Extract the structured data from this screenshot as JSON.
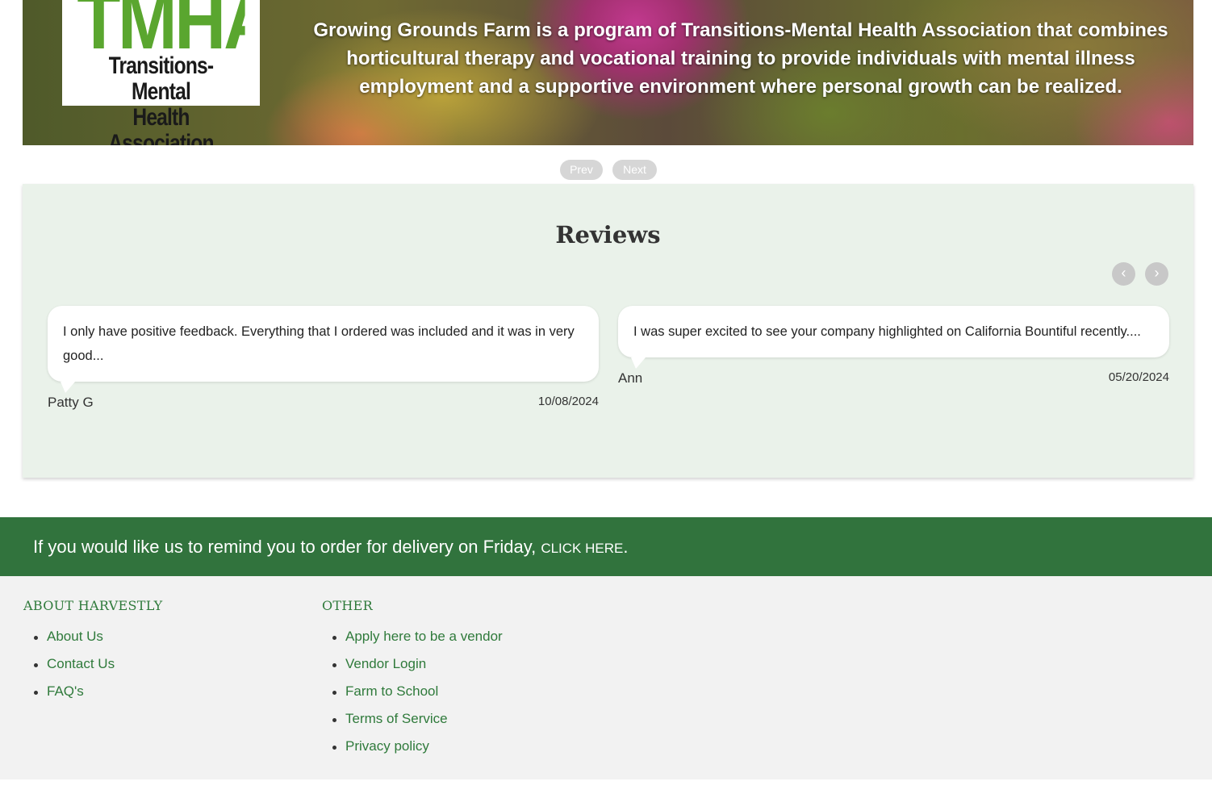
{
  "banner": {
    "logo_mark": "TMHA",
    "logo_name_line1": "Transitions-Mental",
    "logo_name_line2": "Health Association",
    "text": "Growing Grounds Farm is a program of Transitions-Mental Health Association that combines horticultural therapy and vocational training to provide individuals with mental illness employment and a supportive environment where personal growth can be realized."
  },
  "slider": {
    "prev_label": "Prev",
    "next_label": "Next"
  },
  "reviews": {
    "title": "Reviews",
    "nav_prev_icon": "‹",
    "nav_next_icon": "›",
    "items": [
      {
        "text": "I only have positive feedback. Everything that I ordered was included and it was in very good...",
        "author": "Patty G",
        "date": "10/08/2024"
      },
      {
        "text": "I was super excited to see your company highlighted on California Bountiful recently....",
        "author": "Ann",
        "date": "05/20/2024"
      }
    ]
  },
  "reminder": {
    "text": "If you would like us to remind you to order for delivery on Friday, ",
    "link": "CLICK HERE",
    "suffix": "."
  },
  "footer": {
    "about": {
      "heading": "ABOUT HARVESTLY",
      "links": [
        "About Us",
        "Contact Us",
        "FAQ's"
      ]
    },
    "other": {
      "heading": "OTHER",
      "links": [
        "Apply here to be a vendor",
        "Vendor Login",
        "Farm to School",
        "Terms of Service",
        "Privacy policy"
      ]
    }
  },
  "colors": {
    "brand_green": "#31733d",
    "link_green": "#2f7a3b",
    "reviews_bg": "#eaf2ea",
    "footer_bg": "#f2f2f2"
  }
}
